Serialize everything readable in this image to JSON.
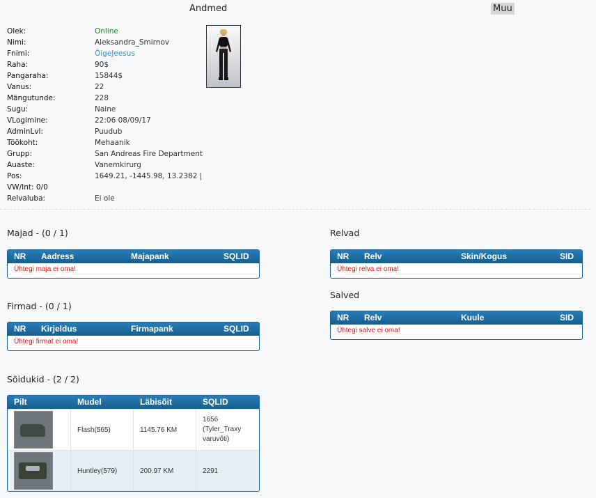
{
  "tabs": {
    "andmed": "Andmed",
    "muu": "Muu"
  },
  "info": [
    {
      "label": "Olek:",
      "value": "Online",
      "style": "online"
    },
    {
      "label": "Nimi:",
      "value": "Aleksandra_Smirnov"
    },
    {
      "label": "Fnimi:",
      "value": "ÕigeJeesus",
      "style": "link"
    },
    {
      "label": "Raha:",
      "value": "90$"
    },
    {
      "label": "Pangaraha:",
      "value": "15844$"
    },
    {
      "label": "Vanus:",
      "value": "22"
    },
    {
      "label": "Mängutunde:",
      "value": "228"
    },
    {
      "label": "Sugu:",
      "value": "Naine"
    },
    {
      "label": "VLogimine:",
      "value": "22:06 08/09/17"
    },
    {
      "label": "AdminLvl:",
      "value": "Puudub"
    },
    {
      "label": "Töökoht:",
      "value": "Mehaanik"
    },
    {
      "label": "Grupp:",
      "value": "San Andreas Fire Department"
    },
    {
      "label": "Auaste:",
      "value": "Vanemkirurg"
    },
    {
      "label": "Pos:",
      "value": "1649.21, -1445.98, 13.2382 |"
    },
    {
      "label": "VW/Int: 0/0",
      "value": "",
      "style": "vw"
    },
    {
      "label": "Relvaluba:",
      "value": "Ei ole"
    }
  ],
  "majad": {
    "title": "Majad - (0 / 1)",
    "headers": [
      "NR",
      "Aadress",
      "Majapank",
      "SQLID"
    ],
    "empty": "Ühtegi maja ei oma!"
  },
  "firmad": {
    "title": "Firmad - (0 / 1)",
    "headers": [
      "NR",
      "Kirjeldus",
      "Firmapank",
      "SQLID"
    ],
    "empty": "Ühtegi firmat ei oma!"
  },
  "relvad": {
    "title": "Relvad",
    "headers": [
      "NR",
      "Relv",
      "Skin/Kogus",
      "SID"
    ],
    "empty": "Ühtegi relva ei oma!"
  },
  "salved": {
    "title": "Salved",
    "headers": [
      "NR",
      "Relv",
      "Kuule",
      "SID"
    ],
    "empty": "Ühtegi salve ei oma!"
  },
  "soidukid": {
    "title": "Sõidukid - (2 / 2)",
    "headers": [
      "Pilt",
      "Mudel",
      "Läbisõit",
      "SQLID"
    ],
    "rows": [
      {
        "model": "Flash(565)",
        "mileage": "1145.76 KM",
        "sqlid": "1656",
        "extra1": "(Tyler_Traxy",
        "extra2": "varuvõti)"
      },
      {
        "model": "Huntley(579)",
        "mileage": "200.97 KM",
        "sqlid": "2291",
        "extra1": "",
        "extra2": ""
      }
    ]
  }
}
